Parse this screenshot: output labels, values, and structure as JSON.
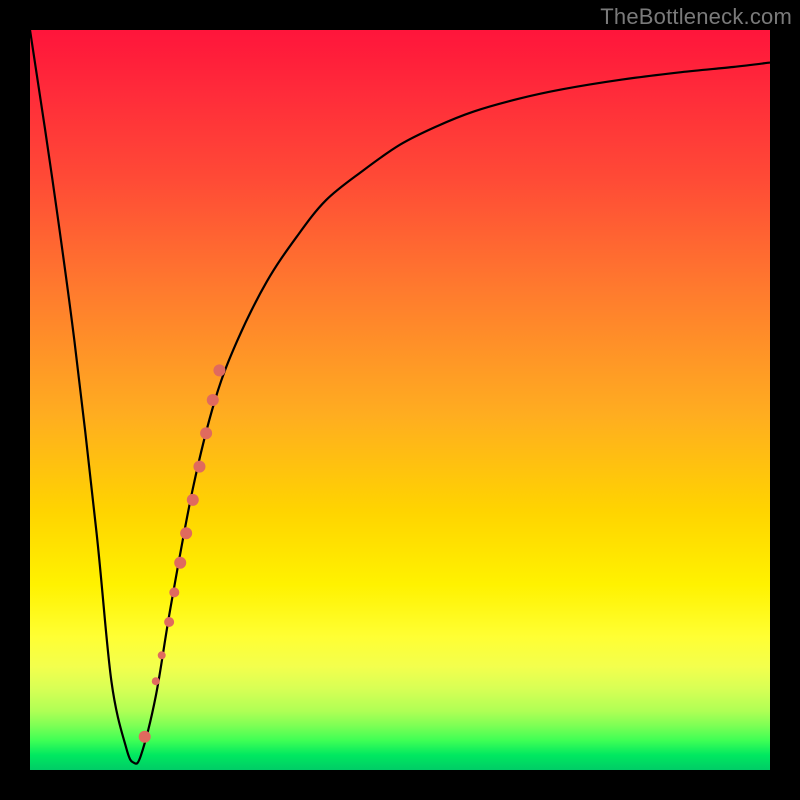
{
  "watermark": {
    "text": "TheBottleneck.com"
  },
  "colors": {
    "curve_stroke": "#000000",
    "dot_fill": "#e06a5e",
    "bg_black": "#000000"
  },
  "chart_data": {
    "type": "line",
    "title": "",
    "xlabel": "",
    "ylabel": "",
    "xlim": [
      0,
      100
    ],
    "ylim": [
      0,
      100
    ],
    "series": [
      {
        "name": "bottleneck-curve",
        "x": [
          0,
          3,
          6,
          9,
          11,
          13,
          14,
          15,
          17,
          19,
          22,
          25,
          28,
          32,
          36,
          40,
          45,
          50,
          55,
          60,
          66,
          72,
          80,
          88,
          95,
          100
        ],
        "y": [
          100,
          80,
          58,
          32,
          12,
          3,
          1,
          2,
          10,
          22,
          38,
          50,
          58,
          66,
          72,
          77,
          81,
          84.5,
          87,
          89,
          90.7,
          92,
          93.3,
          94.3,
          95,
          95.6
        ]
      }
    ],
    "dots": {
      "name": "highlight-dots",
      "points": [
        {
          "x": 15.5,
          "y": 4.5,
          "r": 6
        },
        {
          "x": 17.0,
          "y": 12.0,
          "r": 4
        },
        {
          "x": 17.8,
          "y": 15.5,
          "r": 4
        },
        {
          "x": 18.8,
          "y": 20.0,
          "r": 5
        },
        {
          "x": 19.5,
          "y": 24.0,
          "r": 5
        },
        {
          "x": 20.3,
          "y": 28.0,
          "r": 6
        },
        {
          "x": 21.1,
          "y": 32.0,
          "r": 6
        },
        {
          "x": 22.0,
          "y": 36.5,
          "r": 6
        },
        {
          "x": 22.9,
          "y": 41.0,
          "r": 6
        },
        {
          "x": 23.8,
          "y": 45.5,
          "r": 6
        },
        {
          "x": 24.7,
          "y": 50.0,
          "r": 6
        },
        {
          "x": 25.6,
          "y": 54.0,
          "r": 6
        }
      ]
    }
  }
}
